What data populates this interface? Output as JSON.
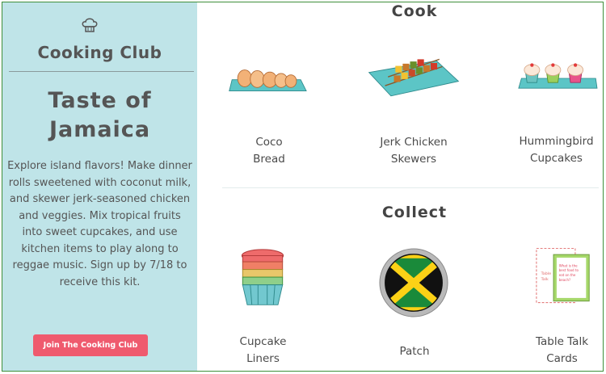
{
  "sidebar": {
    "club_title": "Cooking Club",
    "kit_title": "Taste of Jamaica",
    "description": "Explore island flavors! Make dinner rolls sweetened with coconut milk, and skewer jerk-seasoned chicken and veggies. Mix tropical fruits into sweet cupcakes, and use kitchen items to play along to reggae music. Sign up by 7/18 to receive this kit.",
    "join_button": "Join The Cooking Club",
    "icon": "chef-hat-icon"
  },
  "cook": {
    "heading": "Cook",
    "items": [
      {
        "label": "Coco\nBread",
        "icon": "coco-bread-image"
      },
      {
        "label": "Jerk Chicken\nSkewers",
        "icon": "jerk-chicken-skewers-image"
      },
      {
        "label": "Hummingbird\nCupcakes",
        "icon": "hummingbird-cupcakes-image"
      }
    ]
  },
  "collect": {
    "heading": "Collect",
    "items": [
      {
        "label": "Cupcake\nLiners",
        "icon": "cupcake-liners-image"
      },
      {
        "label": "Patch",
        "icon": "jamaica-flag-patch-image"
      },
      {
        "label": "Table Talk\nCards",
        "icon": "table-talk-cards-image"
      }
    ]
  },
  "colors": {
    "sidebar_bg": "#bfe4e8",
    "button": "#ef5a6e",
    "plate": "#5cc5c6"
  }
}
